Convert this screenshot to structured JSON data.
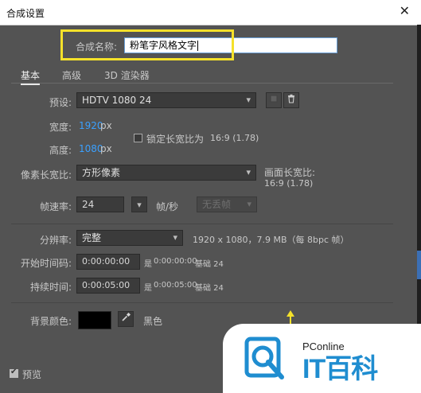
{
  "window": {
    "title": "合成设置"
  },
  "composition": {
    "name_label": "合成名称:",
    "name_value": "粉笔字风格文字"
  },
  "tabs": [
    {
      "label": "基本",
      "active": true
    },
    {
      "label": "高级",
      "active": false
    },
    {
      "label": "3D 渲染器",
      "active": false
    }
  ],
  "preset": {
    "label": "预设:",
    "value": "HDTV 1080 24"
  },
  "width": {
    "label": "宽度:",
    "value": "1920",
    "unit": "px"
  },
  "height": {
    "label": "高度:",
    "value": "1080",
    "unit": "px"
  },
  "lock_aspect": {
    "label": "锁定长宽比为",
    "value": "16:9 (1.78)",
    "checked": false
  },
  "pixel_aspect": {
    "label": "像素长宽比:",
    "value": "方形像素"
  },
  "frame_aspect": {
    "label": "画面长宽比:",
    "value": "16:9 (1.78)"
  },
  "frame_rate": {
    "label": "帧速率:",
    "value": "24",
    "unit": "帧/秒",
    "drop_frame": "无丢帧"
  },
  "resolution": {
    "label": "分辨率:",
    "value": "完整",
    "info": "1920 x 1080，7.9 MB（每 8bpc 帧）"
  },
  "start_timecode": {
    "label": "开始时间码:",
    "value": "0:00:00:00",
    "equals": "0:00:00:00",
    "base": "基础 24"
  },
  "duration": {
    "label": "持续时间:",
    "value": "0:00:05:00",
    "equals": "0:00:05:00",
    "base": "基础 24"
  },
  "background": {
    "label": "背景颜色:",
    "color": "#000000",
    "name": "黑色"
  },
  "preview": {
    "label": "预览",
    "checked": true
  },
  "watermark": {
    "line1": "PConline",
    "line2": "IT百科"
  },
  "colors": {
    "highlight": "#f5e12a",
    "accent_blue": "#3aa0ff"
  }
}
